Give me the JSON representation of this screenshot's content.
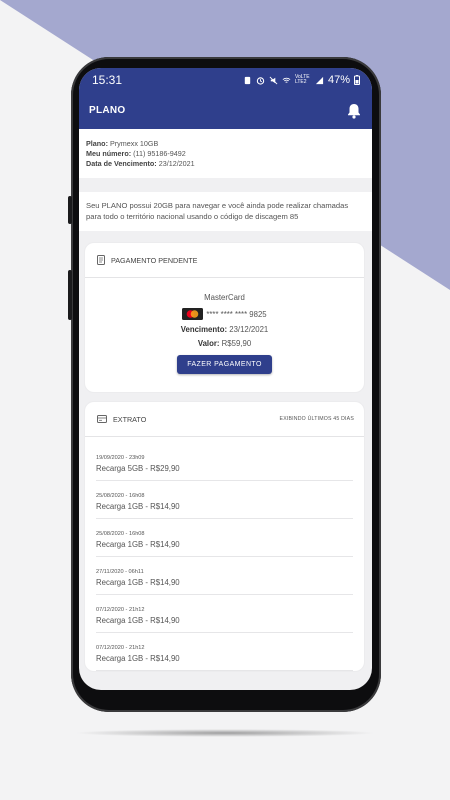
{
  "status_bar": {
    "time": "15:31",
    "network": "VoLTE LTE2",
    "battery": "47%"
  },
  "app_bar": {
    "title": "PLANO"
  },
  "plan": {
    "plan_label": "Plano:",
    "plan_value": "Prymexx 10GB",
    "number_label": "Meu número:",
    "number_value": "(11) 95186-9492",
    "due_label": "Data de Vencimento:",
    "due_value": "23/12/2021"
  },
  "info": {
    "text": "Seu PLANO possui 20GB para navegar e você ainda pode realizar chamadas para todo o território nacional usando o código de discagem 85"
  },
  "payment": {
    "header": "PAGAMENTO PENDENTE",
    "brand": "MasterCard",
    "card_number": "**** **** **** 9825",
    "due_label": "Vencimento:",
    "due_value": "23/12/2021",
    "value_label": "Valor:",
    "value_value": "R$59,90",
    "button": "FAZER PAGAMENTO"
  },
  "extrato": {
    "header": "EXTRATO",
    "filter": "EXIBINDO ÚLTIMOS 45 DIAS",
    "items": [
      {
        "date": "19/09/2020 - 23h09",
        "desc": "Recarga 5GB - R$29,90"
      },
      {
        "date": "25/08/2020 - 16h08",
        "desc": "Recarga 1GB - R$14,90"
      },
      {
        "date": "25/08/2020 - 16h08",
        "desc": "Recarga 1GB - R$14,90"
      },
      {
        "date": "27/11/2020 - 06h11",
        "desc": "Recarga 1GB - R$14,90"
      },
      {
        "date": "07/12/2020 - 21h12",
        "desc": "Recarga 1GB - R$14,90"
      },
      {
        "date": "07/12/2020 - 21h12",
        "desc": "Recarga 1GB - R$14,90"
      }
    ]
  },
  "colors": {
    "primary": "#2f3f8c",
    "background_shape": "#a4a8cf",
    "mastercard_red": "#eb001b",
    "mastercard_yellow": "#f79e1b"
  }
}
